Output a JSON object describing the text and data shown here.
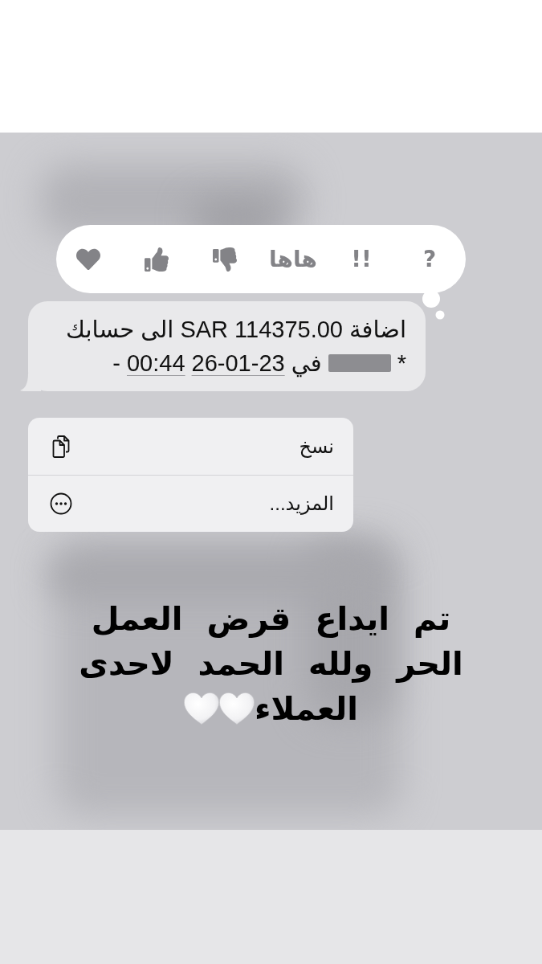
{
  "reaction_bar": {
    "reactions": [
      {
        "kind": "text",
        "label": "?"
      },
      {
        "kind": "text",
        "label": "!!"
      },
      {
        "kind": "text",
        "label": "هاها"
      },
      {
        "kind": "thumbs_down"
      },
      {
        "kind": "thumbs_up"
      },
      {
        "kind": "heart"
      }
    ]
  },
  "message": {
    "line_1": "اضافة SAR 114375.00 الى حسابك",
    "line_2": [
      {
        "kind": "text",
        "text": "*"
      },
      {
        "kind": "redacted"
      },
      {
        "kind": "text",
        "text": "في"
      },
      {
        "kind": "link",
        "text": "26-01-23"
      },
      {
        "kind": "link",
        "text": "00:44"
      },
      {
        "kind": "text",
        "text": "-"
      }
    ]
  },
  "context_menu": {
    "items": [
      {
        "kind": "copy",
        "label": "نسخ"
      },
      {
        "kind": "more",
        "label": "المزيد..."
      }
    ]
  },
  "caption": {
    "lines": [
      "تم ايداع قرض العمل",
      "الحر ولله الحمد لاحدى",
      "العملاء"
    ],
    "emojis": [
      {
        "kind": "heart"
      },
      {
        "kind": "heart"
      }
    ]
  }
}
